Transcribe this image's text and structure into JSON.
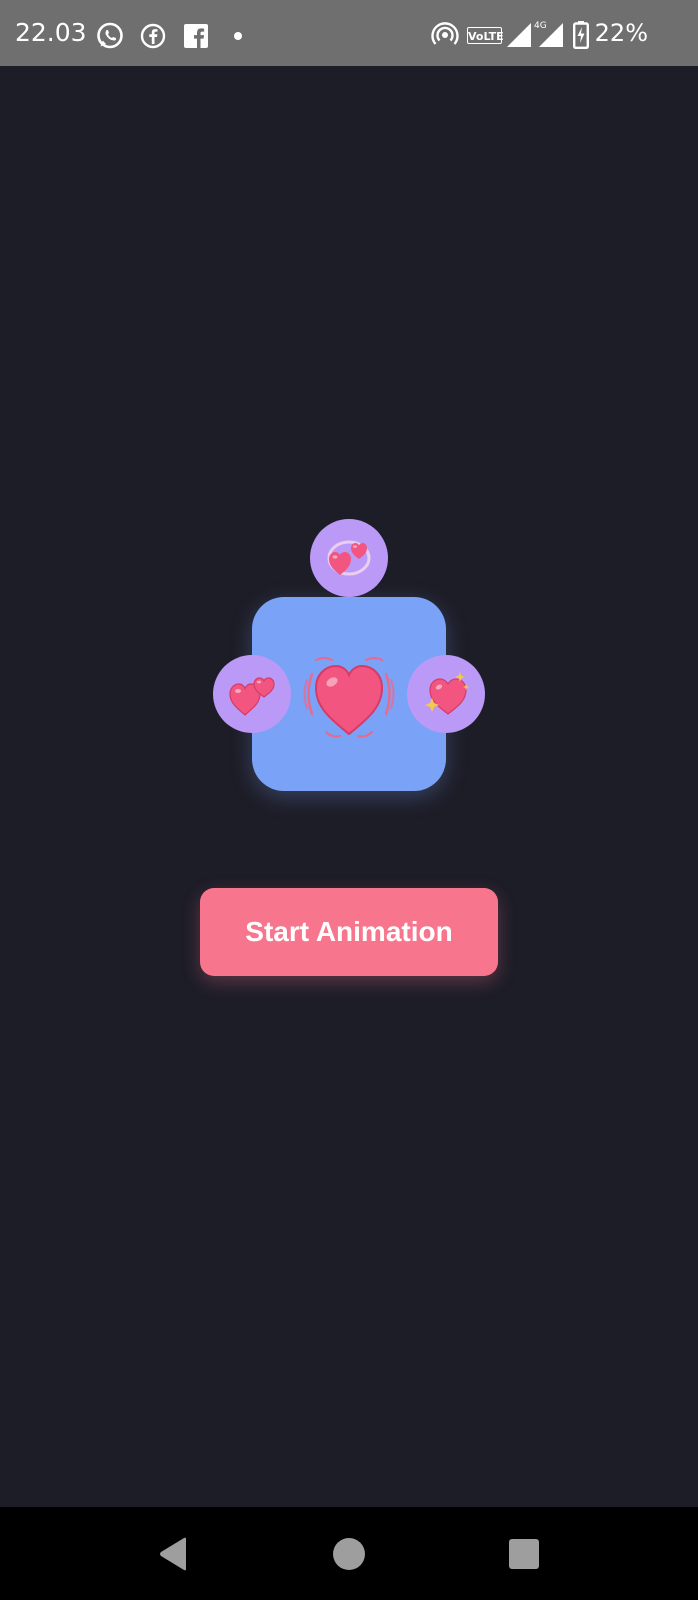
{
  "status_bar": {
    "time": "22.03",
    "network_badge": "VoLTE",
    "network_type": "4G",
    "battery_percent": "22%",
    "icons": [
      "whatsapp-icon",
      "facebook-messenger-icon",
      "facebook-icon",
      "notification-dot-icon",
      "hotspot-icon",
      "volte-icon",
      "signal-icon",
      "signal-4g-icon",
      "battery-charging-icon"
    ]
  },
  "animation": {
    "center_emoji": "beating-heart",
    "orbit_emojis": [
      "revolving-hearts",
      "two-hearts",
      "sparkling-heart"
    ],
    "colors": {
      "background": "#1d1d27",
      "box": "#7aa2f7",
      "orbit": "#bb9af7",
      "heart": "#f2557f"
    }
  },
  "start_button": {
    "label": "Start Animation",
    "color": "#f7768e"
  },
  "nav_bar": {
    "icons": [
      "back-icon",
      "home-icon",
      "recents-icon"
    ]
  }
}
